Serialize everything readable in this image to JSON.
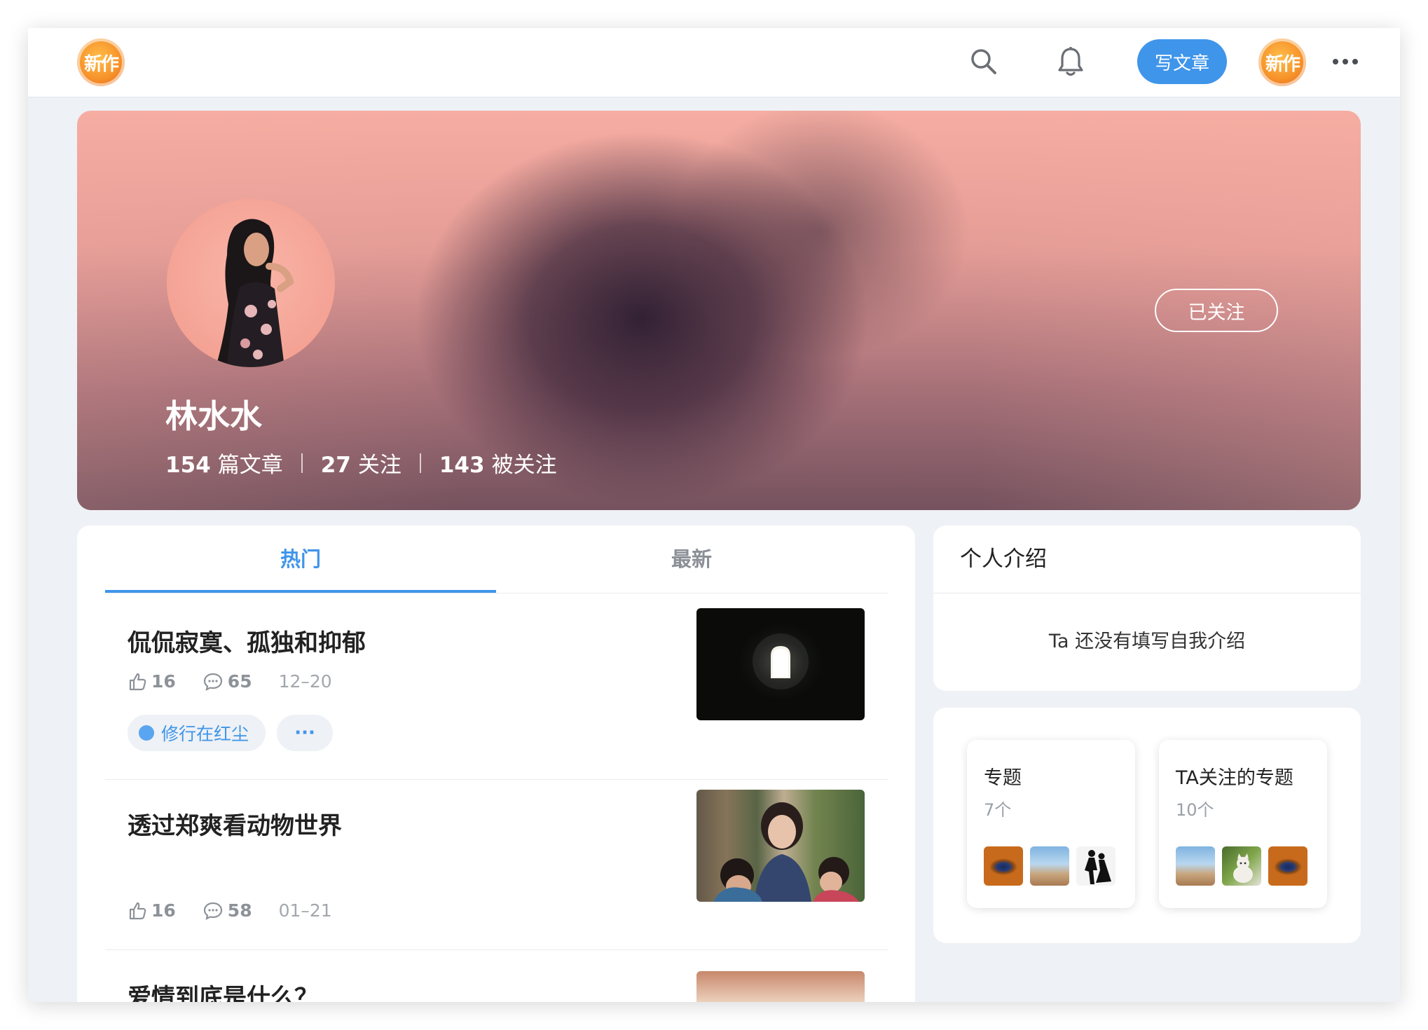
{
  "topbar": {
    "logo_text": "新作",
    "write_label": "写文章",
    "avatar_text": "新作",
    "icons": {
      "search": "search-icon",
      "notifications": "bell-icon",
      "more": "more-horizontal-icon"
    }
  },
  "profile": {
    "name": "林水水",
    "articles_count": "154",
    "articles_label": "篇文章",
    "following_count": "27",
    "following_label": "关注",
    "followers_count": "143",
    "followers_label": "被关注",
    "follow_state_label": "已关注"
  },
  "tabs": [
    {
      "label": "热门",
      "active": true
    },
    {
      "label": "最新",
      "active": false
    }
  ],
  "articles": [
    {
      "title": "侃侃寂寞、孤独和抑郁",
      "likes": "16",
      "comments": "65",
      "date": "12–20",
      "tag": "修行在红尘",
      "tag_more": "···"
    },
    {
      "title": "透过郑爽看动物世界",
      "likes": "16",
      "comments": "58",
      "date": "01–21"
    },
    {
      "title": "爱情到底是什么？"
    }
  ],
  "intro": {
    "title": "个人介绍",
    "text": "Ta 还没有填写自我介绍"
  },
  "topics": [
    {
      "name": "专题",
      "count": "7个"
    },
    {
      "name": "TA关注的专题",
      "count": "10个"
    }
  ],
  "colors": {
    "accent": "#3f95ea",
    "background": "#eef1f5",
    "card": "#ffffff",
    "muted_text": "#8d9299"
  }
}
